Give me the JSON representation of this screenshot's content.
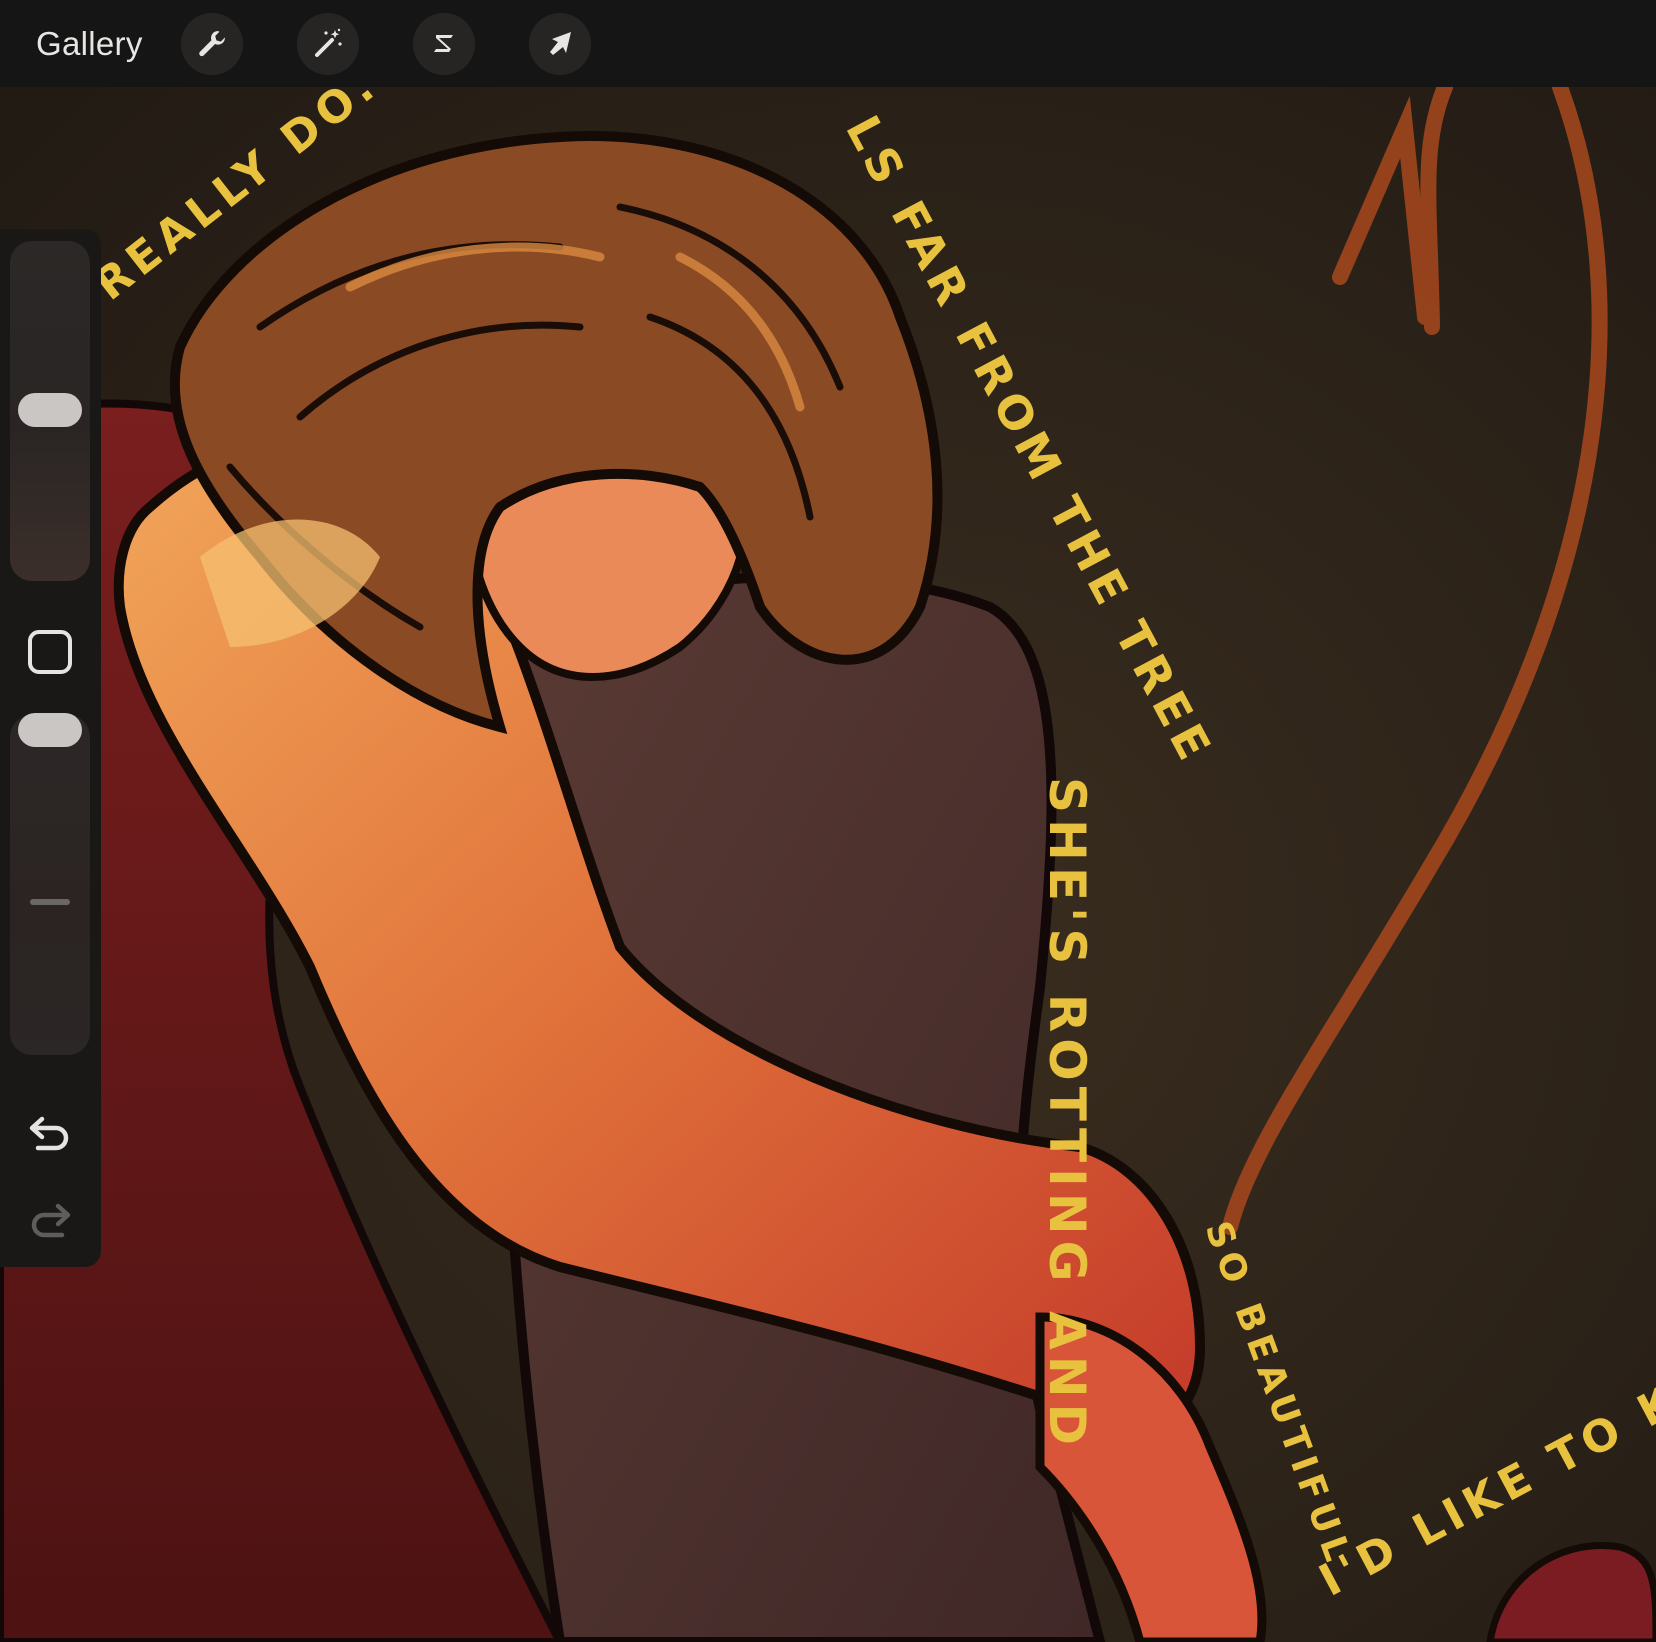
{
  "toolbar": {
    "gallery_label": "Gallery",
    "tools": [
      "wrench-icon",
      "magic-wand-icon",
      "selection-icon",
      "transform-arrow-icon"
    ]
  },
  "canvas": {
    "lettering": {
      "line1": "REALLY DO. THE",
      "line2": "LS FAR FROM THE TREE",
      "line3": "SHE'S ROTTING AND",
      "line4": "SO BEAUTIFUL",
      "line5": "I'D LIKE TO K"
    }
  },
  "sidebar": {
    "controls": [
      "brush-size-slider",
      "modify-square-icon",
      "opacity-slider",
      "undo-icon",
      "redo-icon"
    ]
  },
  "colors": {
    "toolbar_bg": "#161515",
    "sidebar_bg": "#191817",
    "lettering": "#e8c23e",
    "background": "#2d2318"
  }
}
